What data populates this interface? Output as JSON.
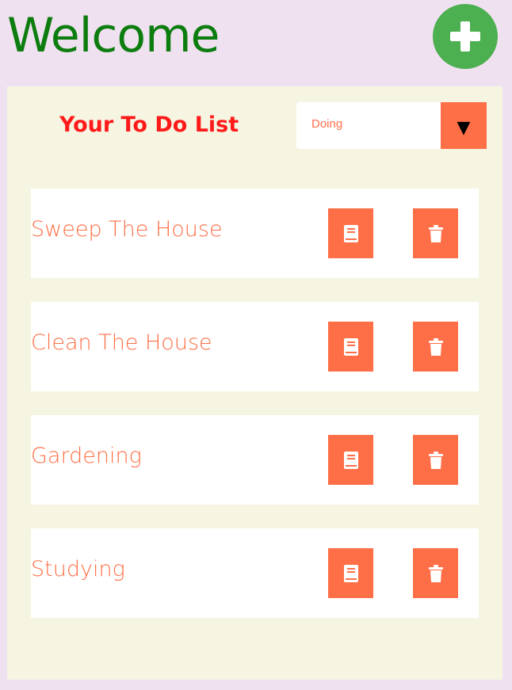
{
  "header": {
    "title": "Welcome",
    "add_icon": "plus-icon",
    "add_color": "#4caf50",
    "title_color": "#0d7d10"
  },
  "panel": {
    "title": "Your To Do List",
    "filter": {
      "selected": "Doing",
      "caret": "▼"
    }
  },
  "todos": [
    {
      "label": "Sweep The House",
      "edit_icon": "book-icon",
      "delete_icon": "trash-icon"
    },
    {
      "label": "Clean The House",
      "edit_icon": "book-icon",
      "delete_icon": "trash-icon"
    },
    {
      "label": "Gardening",
      "edit_icon": "book-icon",
      "delete_icon": "trash-icon"
    },
    {
      "label": "Studying",
      "edit_icon": "book-icon",
      "delete_icon": "trash-icon"
    }
  ],
  "colors": {
    "background": "#f0e1f0",
    "panel": "#f5f5e2",
    "accent": "#ff6f47",
    "list_title": "#ff1a1a"
  }
}
